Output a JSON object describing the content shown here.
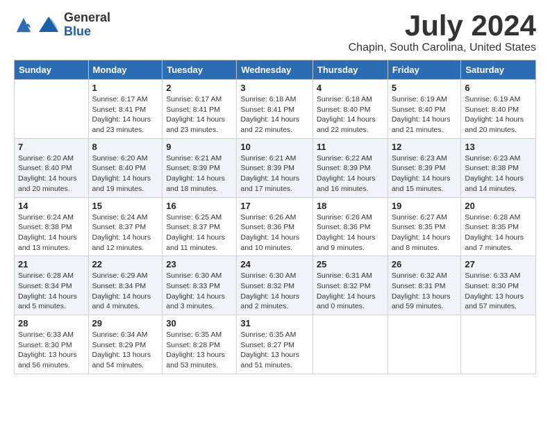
{
  "logo": {
    "general": "General",
    "blue": "Blue"
  },
  "title": "July 2024",
  "location": "Chapin, South Carolina, United States",
  "days_of_week": [
    "Sunday",
    "Monday",
    "Tuesday",
    "Wednesday",
    "Thursday",
    "Friday",
    "Saturday"
  ],
  "weeks": [
    [
      {
        "num": "",
        "sunrise": "",
        "sunset": "",
        "daylight": ""
      },
      {
        "num": "1",
        "sunrise": "Sunrise: 6:17 AM",
        "sunset": "Sunset: 8:41 PM",
        "daylight": "Daylight: 14 hours and 23 minutes."
      },
      {
        "num": "2",
        "sunrise": "Sunrise: 6:17 AM",
        "sunset": "Sunset: 8:41 PM",
        "daylight": "Daylight: 14 hours and 23 minutes."
      },
      {
        "num": "3",
        "sunrise": "Sunrise: 6:18 AM",
        "sunset": "Sunset: 8:41 PM",
        "daylight": "Daylight: 14 hours and 22 minutes."
      },
      {
        "num": "4",
        "sunrise": "Sunrise: 6:18 AM",
        "sunset": "Sunset: 8:40 PM",
        "daylight": "Daylight: 14 hours and 22 minutes."
      },
      {
        "num": "5",
        "sunrise": "Sunrise: 6:19 AM",
        "sunset": "Sunset: 8:40 PM",
        "daylight": "Daylight: 14 hours and 21 minutes."
      },
      {
        "num": "6",
        "sunrise": "Sunrise: 6:19 AM",
        "sunset": "Sunset: 8:40 PM",
        "daylight": "Daylight: 14 hours and 20 minutes."
      }
    ],
    [
      {
        "num": "7",
        "sunrise": "Sunrise: 6:20 AM",
        "sunset": "Sunset: 8:40 PM",
        "daylight": "Daylight: 14 hours and 20 minutes."
      },
      {
        "num": "8",
        "sunrise": "Sunrise: 6:20 AM",
        "sunset": "Sunset: 8:40 PM",
        "daylight": "Daylight: 14 hours and 19 minutes."
      },
      {
        "num": "9",
        "sunrise": "Sunrise: 6:21 AM",
        "sunset": "Sunset: 8:39 PM",
        "daylight": "Daylight: 14 hours and 18 minutes."
      },
      {
        "num": "10",
        "sunrise": "Sunrise: 6:21 AM",
        "sunset": "Sunset: 8:39 PM",
        "daylight": "Daylight: 14 hours and 17 minutes."
      },
      {
        "num": "11",
        "sunrise": "Sunrise: 6:22 AM",
        "sunset": "Sunset: 8:39 PM",
        "daylight": "Daylight: 14 hours and 16 minutes."
      },
      {
        "num": "12",
        "sunrise": "Sunrise: 6:23 AM",
        "sunset": "Sunset: 8:39 PM",
        "daylight": "Daylight: 14 hours and 15 minutes."
      },
      {
        "num": "13",
        "sunrise": "Sunrise: 6:23 AM",
        "sunset": "Sunset: 8:38 PM",
        "daylight": "Daylight: 14 hours and 14 minutes."
      }
    ],
    [
      {
        "num": "14",
        "sunrise": "Sunrise: 6:24 AM",
        "sunset": "Sunset: 8:38 PM",
        "daylight": "Daylight: 14 hours and 13 minutes."
      },
      {
        "num": "15",
        "sunrise": "Sunrise: 6:24 AM",
        "sunset": "Sunset: 8:37 PM",
        "daylight": "Daylight: 14 hours and 12 minutes."
      },
      {
        "num": "16",
        "sunrise": "Sunrise: 6:25 AM",
        "sunset": "Sunset: 8:37 PM",
        "daylight": "Daylight: 14 hours and 11 minutes."
      },
      {
        "num": "17",
        "sunrise": "Sunrise: 6:26 AM",
        "sunset": "Sunset: 8:36 PM",
        "daylight": "Daylight: 14 hours and 10 minutes."
      },
      {
        "num": "18",
        "sunrise": "Sunrise: 6:26 AM",
        "sunset": "Sunset: 8:36 PM",
        "daylight": "Daylight: 14 hours and 9 minutes."
      },
      {
        "num": "19",
        "sunrise": "Sunrise: 6:27 AM",
        "sunset": "Sunset: 8:35 PM",
        "daylight": "Daylight: 14 hours and 8 minutes."
      },
      {
        "num": "20",
        "sunrise": "Sunrise: 6:28 AM",
        "sunset": "Sunset: 8:35 PM",
        "daylight": "Daylight: 14 hours and 7 minutes."
      }
    ],
    [
      {
        "num": "21",
        "sunrise": "Sunrise: 6:28 AM",
        "sunset": "Sunset: 8:34 PM",
        "daylight": "Daylight: 14 hours and 5 minutes."
      },
      {
        "num": "22",
        "sunrise": "Sunrise: 6:29 AM",
        "sunset": "Sunset: 8:34 PM",
        "daylight": "Daylight: 14 hours and 4 minutes."
      },
      {
        "num": "23",
        "sunrise": "Sunrise: 6:30 AM",
        "sunset": "Sunset: 8:33 PM",
        "daylight": "Daylight: 14 hours and 3 minutes."
      },
      {
        "num": "24",
        "sunrise": "Sunrise: 6:30 AM",
        "sunset": "Sunset: 8:32 PM",
        "daylight": "Daylight: 14 hours and 2 minutes."
      },
      {
        "num": "25",
        "sunrise": "Sunrise: 6:31 AM",
        "sunset": "Sunset: 8:32 PM",
        "daylight": "Daylight: 14 hours and 0 minutes."
      },
      {
        "num": "26",
        "sunrise": "Sunrise: 6:32 AM",
        "sunset": "Sunset: 8:31 PM",
        "daylight": "Daylight: 13 hours and 59 minutes."
      },
      {
        "num": "27",
        "sunrise": "Sunrise: 6:33 AM",
        "sunset": "Sunset: 8:30 PM",
        "daylight": "Daylight: 13 hours and 57 minutes."
      }
    ],
    [
      {
        "num": "28",
        "sunrise": "Sunrise: 6:33 AM",
        "sunset": "Sunset: 8:30 PM",
        "daylight": "Daylight: 13 hours and 56 minutes."
      },
      {
        "num": "29",
        "sunrise": "Sunrise: 6:34 AM",
        "sunset": "Sunset: 8:29 PM",
        "daylight": "Daylight: 13 hours and 54 minutes."
      },
      {
        "num": "30",
        "sunrise": "Sunrise: 6:35 AM",
        "sunset": "Sunset: 8:28 PM",
        "daylight": "Daylight: 13 hours and 53 minutes."
      },
      {
        "num": "31",
        "sunrise": "Sunrise: 6:35 AM",
        "sunset": "Sunset: 8:27 PM",
        "daylight": "Daylight: 13 hours and 51 minutes."
      },
      {
        "num": "",
        "sunrise": "",
        "sunset": "",
        "daylight": ""
      },
      {
        "num": "",
        "sunrise": "",
        "sunset": "",
        "daylight": ""
      },
      {
        "num": "",
        "sunrise": "",
        "sunset": "",
        "daylight": ""
      }
    ]
  ]
}
